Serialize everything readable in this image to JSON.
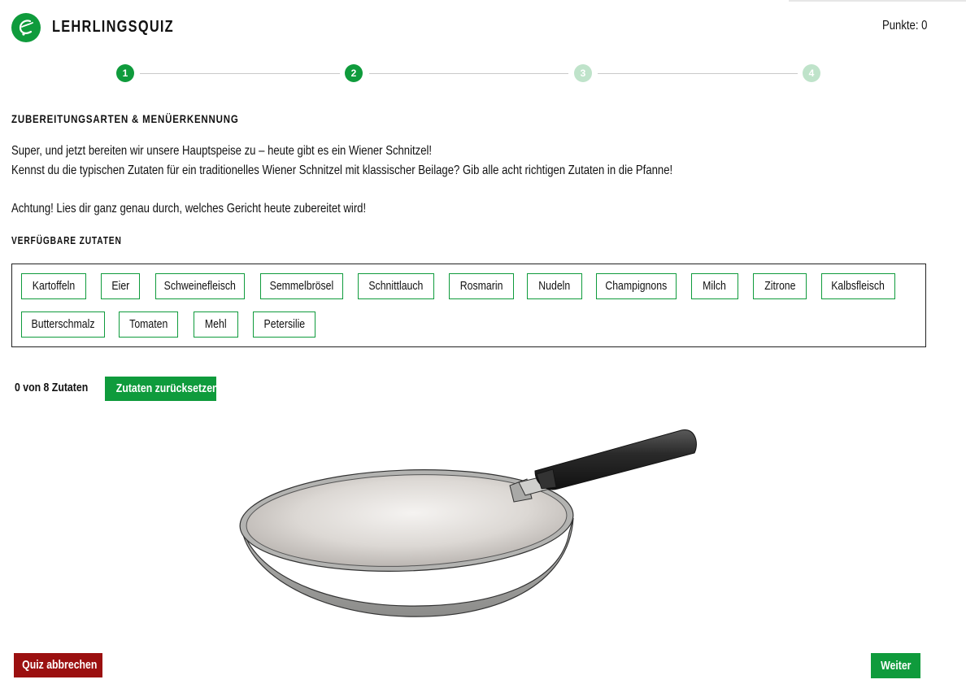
{
  "header": {
    "app_title": "LEHRLINGSQUIZ",
    "logo_icon": "chef-hat-logo-icon",
    "points_label": "Punkte: 0"
  },
  "stepper": {
    "steps": [
      {
        "label": "1",
        "state": "active"
      },
      {
        "label": "2",
        "state": "active"
      },
      {
        "label": "3",
        "state": "inactive"
      },
      {
        "label": "4",
        "state": "inactive"
      }
    ]
  },
  "content": {
    "section_title": "ZUBEREITUNGSARTEN & MENÜERKENNUNG",
    "intro_line1": "Super, und jetzt bereiten wir unsere Hauptspeise zu – heute gibt es ein Wiener Schnitzel!",
    "intro_line2": "Kennst du die typischen Zutaten für ein traditionelles Wiener Schnitzel mit klassischer Beilage? Gib alle acht richtigen Zutaten in die Pfanne!",
    "warning": "Achtung! Lies dir ganz genau durch, welches Gericht heute zubereitet wird!",
    "available_title": "VERFÜGBARE ZUTATEN"
  },
  "ingredients": [
    "Kartoffeln",
    "Eier",
    "Schweinefleisch",
    "Semmelbrösel",
    "Schnittlauch",
    "Rosmarin",
    "Nudeln",
    "Champignons",
    "Milch",
    "Zitrone",
    "Kalbsfleisch",
    "Butterschmalz",
    "Tomaten",
    "Mehl",
    "Petersilie"
  ],
  "pan_area": {
    "counter": "0 von 8 Zutaten",
    "reset_label": "Zutaten zurücksetzen",
    "pan_icon": "frying-pan-illustration"
  },
  "footer": {
    "cancel_label": "Quiz abbrechen",
    "next_label": "Weiter"
  },
  "colors": {
    "brand_green": "#0f9b3c",
    "step_inactive": "#bfe3ca",
    "cancel_red": "#9b1010"
  }
}
